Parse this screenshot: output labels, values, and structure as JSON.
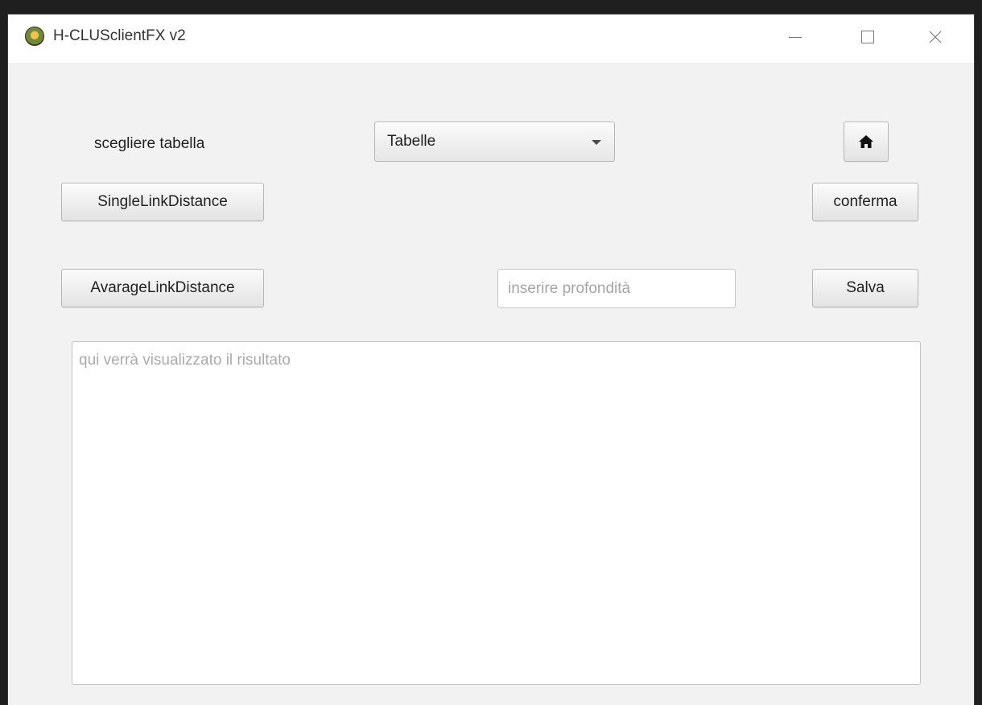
{
  "window": {
    "title": "H-CLUSclientFX v2",
    "controls": {
      "minimize_icon": "minimize-icon",
      "maximize_icon": "maximize-icon",
      "close_icon": "close-icon"
    }
  },
  "form": {
    "choose_table_label": "scegliere tabella",
    "table_select": {
      "value": "Tabelle"
    },
    "home_icon": "home-icon",
    "single_link_button": "SingleLinkDistance",
    "confirm_button": "conferma",
    "average_link_button": "AvarageLinkDistance",
    "depth_input": {
      "value": "",
      "placeholder": "inserire profondità"
    },
    "save_button": "Salva",
    "result_area": {
      "value": "",
      "placeholder": "qui verrà visualizzato il risultato"
    }
  },
  "colors": {
    "window_bg": "#f2f2f2",
    "titlebar_bg": "#ffffff",
    "button_border": "#b6b6b6",
    "placeholder": "#a6a6a6"
  }
}
